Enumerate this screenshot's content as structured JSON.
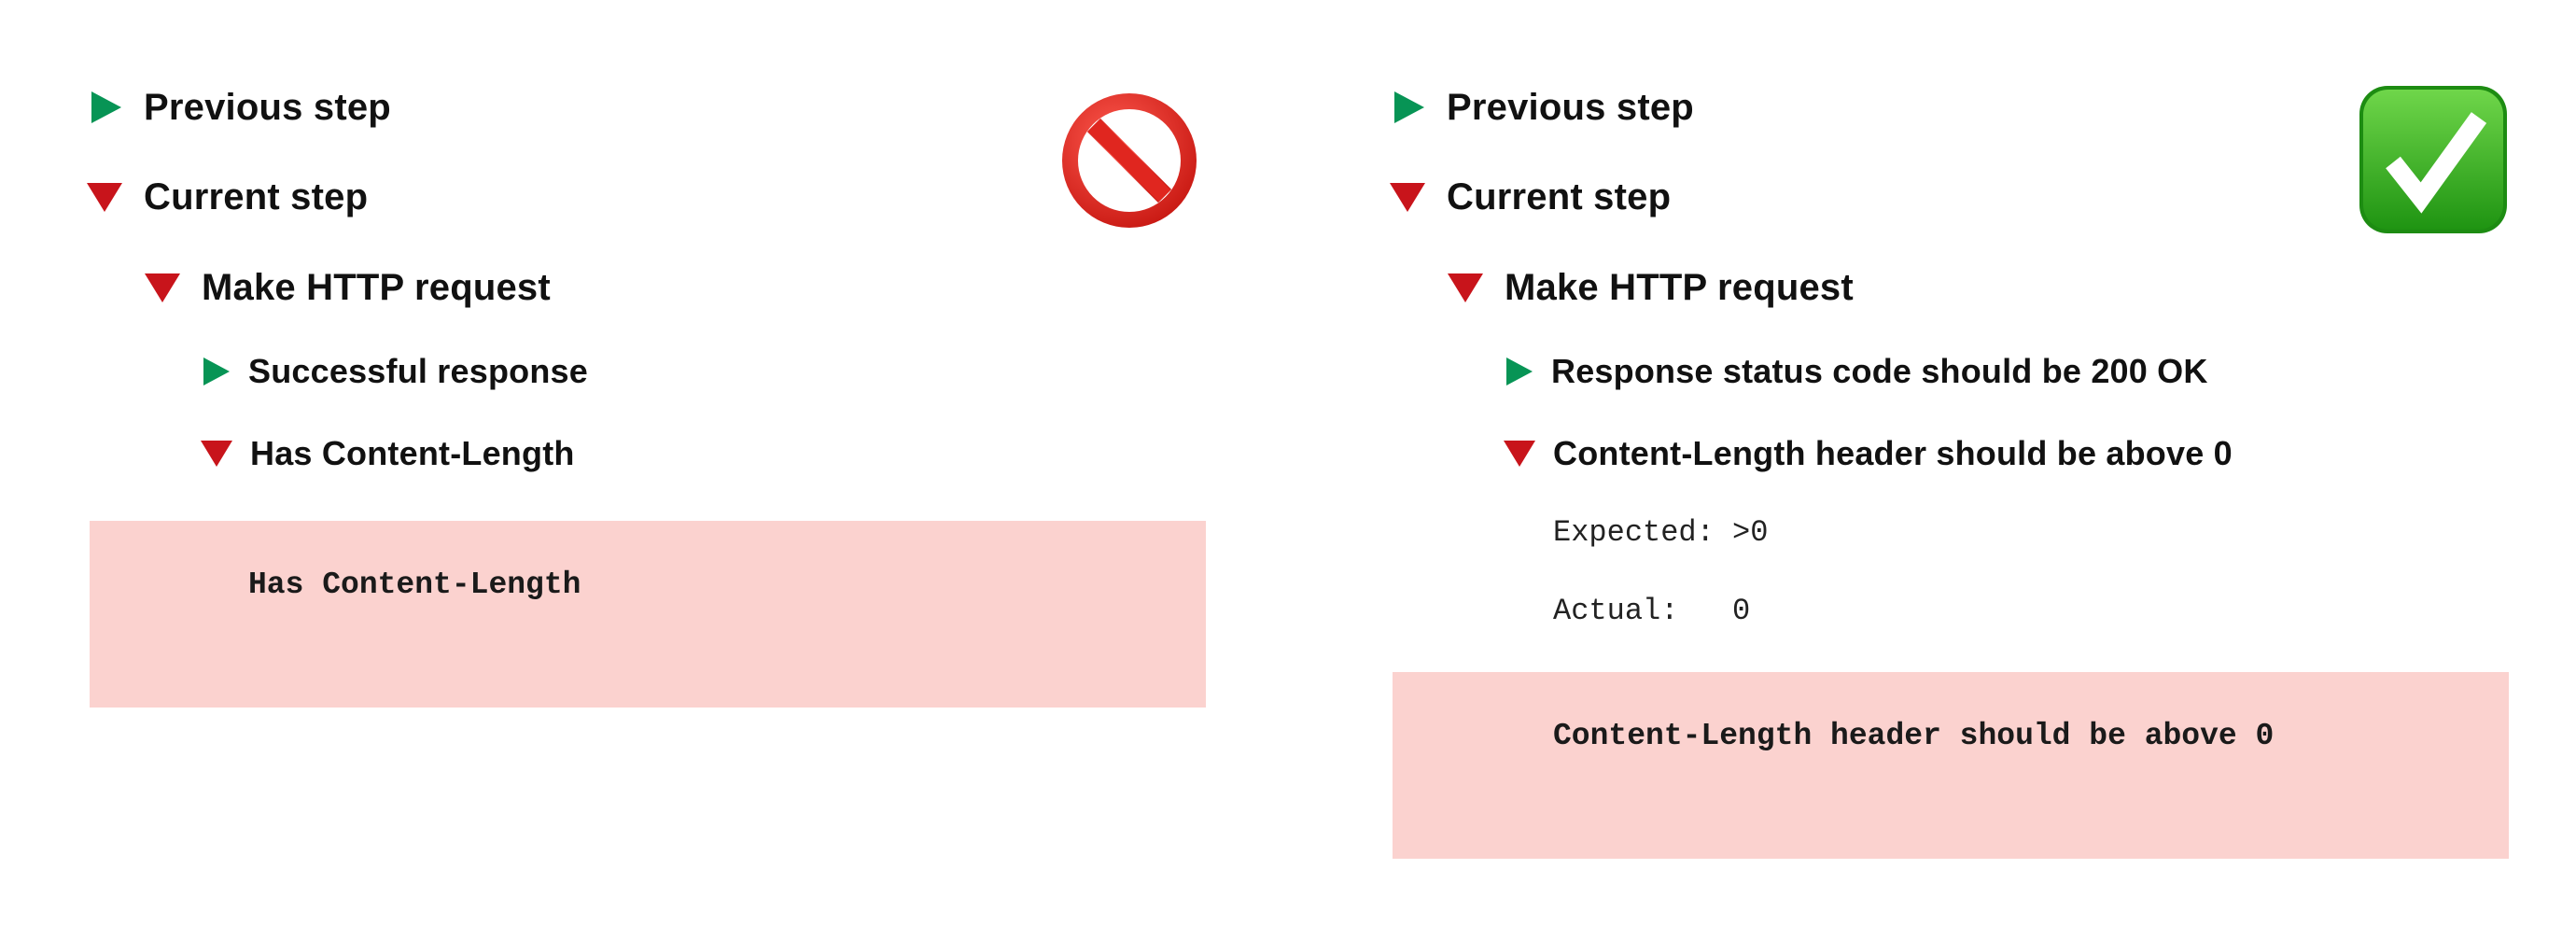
{
  "colors": {
    "collapsed_triangle": "#079455",
    "expanded_triangle": "#c8141b",
    "error_background": "#fbd2cf",
    "prohibited": "#e0261f",
    "check_green": "#3cb02b"
  },
  "left_panel": {
    "verdict_icon": "prohibited-icon",
    "tree": {
      "previous_step": {
        "label": "Previous step",
        "state": "collapsed"
      },
      "current_step": {
        "label": "Current step",
        "state": "expanded"
      },
      "http_request": {
        "label": "Make HTTP request",
        "state": "expanded"
      },
      "check_1": {
        "label": "Successful response",
        "state": "collapsed"
      },
      "check_2": {
        "label": "Has Content-Length",
        "state": "expanded"
      }
    },
    "error_message": "Has Content-Length"
  },
  "right_panel": {
    "verdict_icon": "check-mark-icon",
    "tree": {
      "previous_step": {
        "label": "Previous step",
        "state": "collapsed"
      },
      "current_step": {
        "label": "Current step",
        "state": "expanded"
      },
      "http_request": {
        "label": "Make HTTP request",
        "state": "expanded"
      },
      "check_1": {
        "label": "Response status code should be 200 OK",
        "state": "collapsed"
      },
      "check_2": {
        "label": "Content-Length header should be above 0",
        "state": "expanded"
      }
    },
    "details": {
      "expected": "Expected: >0",
      "actual": "Actual:   0"
    },
    "error_message": "Content-Length header should be above 0"
  }
}
